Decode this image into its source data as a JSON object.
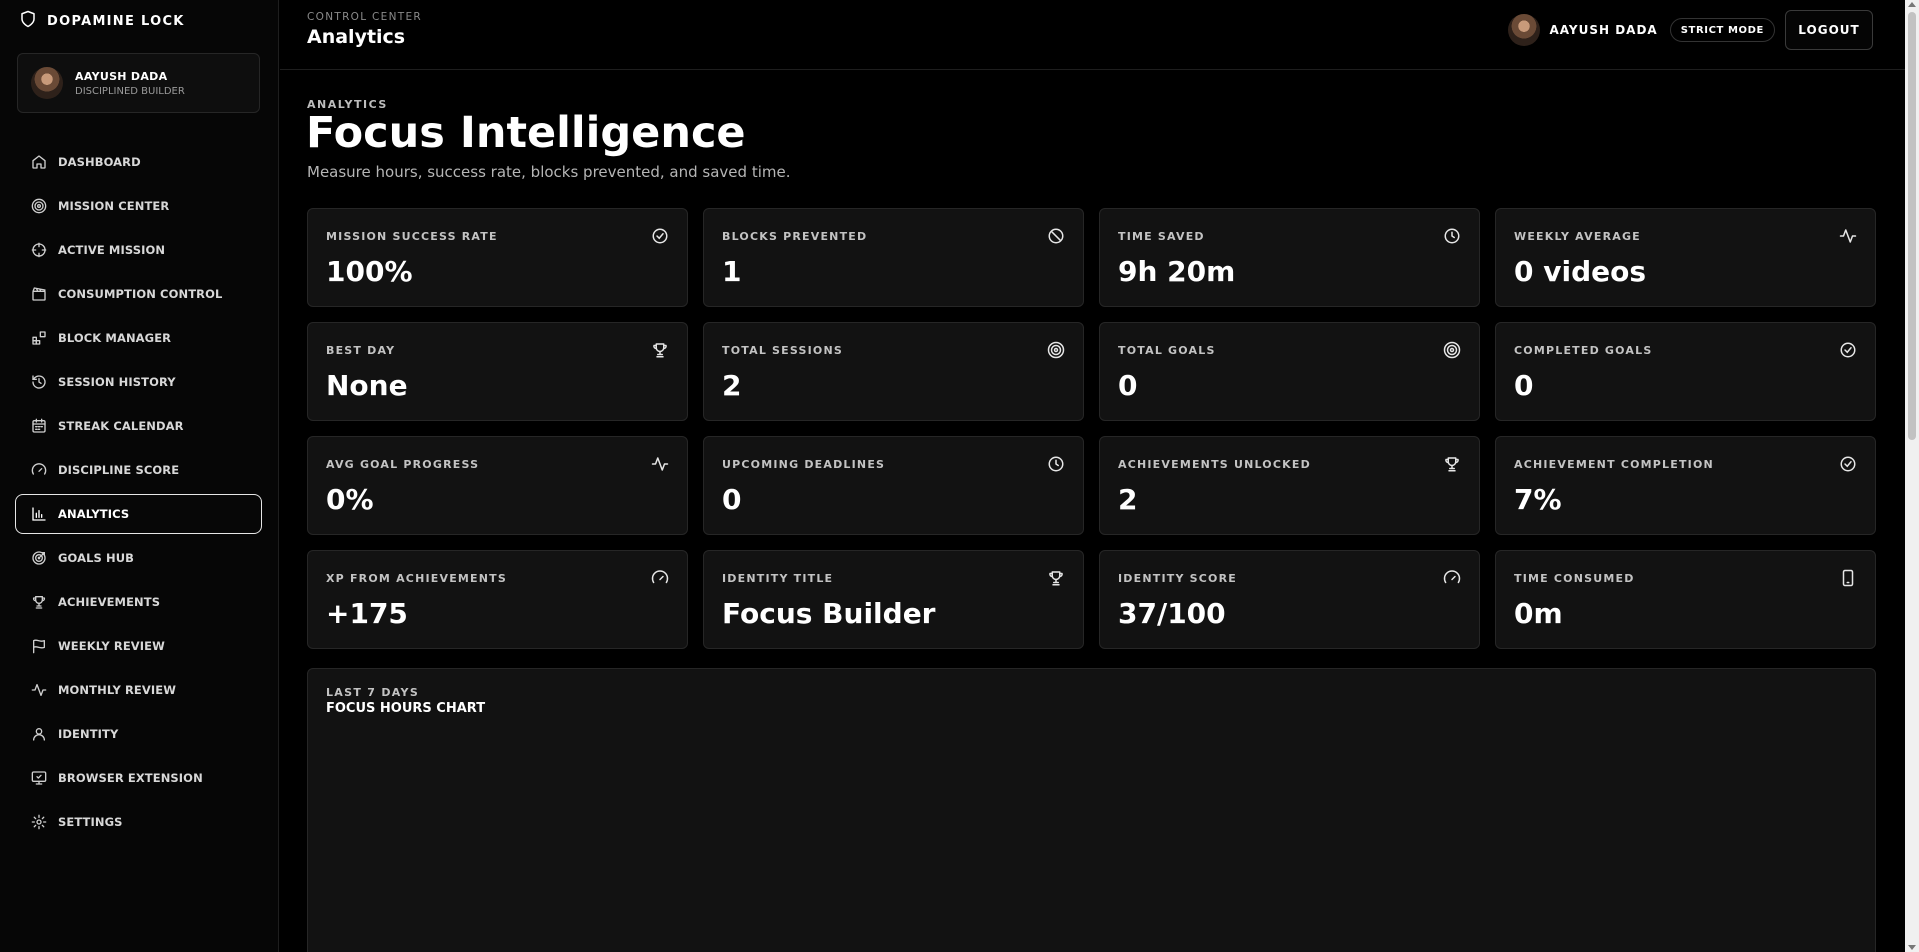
{
  "brand": {
    "name": "DOPAMINE LOCK",
    "icon": "shield-icon"
  },
  "sidebar_user": {
    "name": "AAYUSH DADA",
    "role": "DISCIPLINED BUILDER"
  },
  "nav": [
    {
      "label": "DASHBOARD",
      "icon": "home-icon",
      "active": false
    },
    {
      "label": "MISSION CENTER",
      "icon": "target-icon",
      "active": false
    },
    {
      "label": "ACTIVE MISSION",
      "icon": "crosshair-icon",
      "active": false
    },
    {
      "label": "CONSUMPTION CONTROL",
      "icon": "clapperboard-icon",
      "active": false
    },
    {
      "label": "BLOCK MANAGER",
      "icon": "blocks-icon",
      "active": false
    },
    {
      "label": "SESSION HISTORY",
      "icon": "history-icon",
      "active": false
    },
    {
      "label": "STREAK CALENDAR",
      "icon": "calendar-icon",
      "active": false
    },
    {
      "label": "DISCIPLINE SCORE",
      "icon": "gauge-icon",
      "active": false
    },
    {
      "label": "ANALYTICS",
      "icon": "bar-chart-icon",
      "active": true
    },
    {
      "label": "GOALS HUB",
      "icon": "goal-icon",
      "active": false
    },
    {
      "label": "ACHIEVEMENTS",
      "icon": "trophy-icon",
      "active": false
    },
    {
      "label": "WEEKLY REVIEW",
      "icon": "flag-icon",
      "active": false
    },
    {
      "label": "MONTHLY REVIEW",
      "icon": "activity-icon",
      "active": false
    },
    {
      "label": "IDENTITY",
      "icon": "user-icon",
      "active": false
    },
    {
      "label": "BROWSER EXTENSION",
      "icon": "monitor-check-icon",
      "active": false
    },
    {
      "label": "SETTINGS",
      "icon": "gear-icon",
      "active": false
    }
  ],
  "header": {
    "breadcrumb": "CONTROL CENTER",
    "title": "Analytics",
    "user_name": "AAYUSH DADA",
    "mode_badge": "STRICT MODE",
    "logout_label": "LOGOUT"
  },
  "page": {
    "eyebrow": "ANALYTICS",
    "title": "Focus Intelligence",
    "subtitle": "Measure hours, success rate, blocks prevented, and saved time."
  },
  "stats": [
    {
      "label": "MISSION SUCCESS RATE",
      "value": "100%",
      "icon": "check-circle-icon"
    },
    {
      "label": "BLOCKS PREVENTED",
      "value": "1",
      "icon": "ban-icon"
    },
    {
      "label": "TIME SAVED",
      "value": "9h 20m",
      "icon": "clock-icon"
    },
    {
      "label": "WEEKLY AVERAGE",
      "value": "0 videos",
      "icon": "activity-icon"
    },
    {
      "label": "BEST DAY",
      "value": "None",
      "icon": "trophy-icon"
    },
    {
      "label": "TOTAL SESSIONS",
      "value": "2",
      "icon": "target-icon"
    },
    {
      "label": "TOTAL GOALS",
      "value": "0",
      "icon": "target-icon"
    },
    {
      "label": "COMPLETED GOALS",
      "value": "0",
      "icon": "check-circle-icon"
    },
    {
      "label": "AVG GOAL PROGRESS",
      "value": "0%",
      "icon": "activity-icon"
    },
    {
      "label": "UPCOMING DEADLINES",
      "value": "0",
      "icon": "clock-icon"
    },
    {
      "label": "ACHIEVEMENTS UNLOCKED",
      "value": "2",
      "icon": "trophy-icon"
    },
    {
      "label": "ACHIEVEMENT COMPLETION",
      "value": "7%",
      "icon": "check-circle-icon"
    },
    {
      "label": "XP FROM ACHIEVEMENTS",
      "value": "+175",
      "icon": "gauge-icon"
    },
    {
      "label": "IDENTITY TITLE",
      "value": "Focus Builder",
      "icon": "trophy-icon"
    },
    {
      "label": "IDENTITY SCORE",
      "value": "37/100",
      "icon": "gauge-icon"
    },
    {
      "label": "TIME CONSUMED",
      "value": "0m",
      "icon": "smartphone-icon"
    }
  ],
  "chart_section": {
    "eyebrow": "LAST 7 DAYS",
    "title": "FOCUS HOURS CHART"
  }
}
